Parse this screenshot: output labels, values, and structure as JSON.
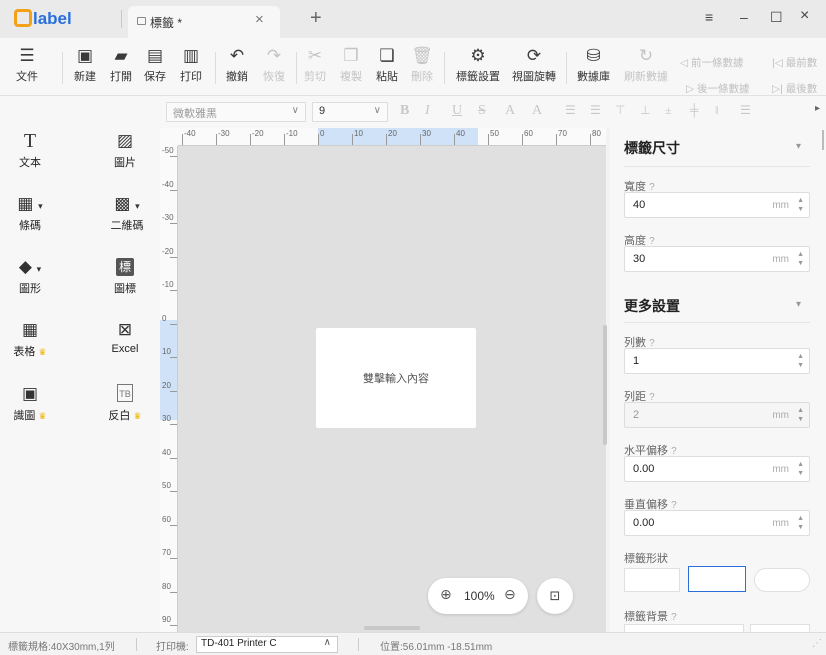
{
  "app": {
    "logo": "label",
    "tab_title": "標籤 *"
  },
  "window": {
    "menu_icon": "≡",
    "minimize": "–",
    "maximize": "☐",
    "close": "×",
    "new_tab": "+",
    "tab_close": "×"
  },
  "toolbar": {
    "file": "文件",
    "new": "新建",
    "open": "打開",
    "save": "保存",
    "print": "打印",
    "undo": "撤銷",
    "redo": "恢復",
    "cut": "剪切",
    "copy": "複製",
    "paste": "粘貼",
    "delete": "刪除",
    "label_settings": "標籤設置",
    "view_rotate": "視圖旋轉",
    "database": "數據庫",
    "refresh_data": "刷新數據",
    "prev_data": "前一條數據",
    "first_data": "最前數",
    "next_data": "後一條數據",
    "last_data": "最後數"
  },
  "left_tools": {
    "text": "文本",
    "image": "圖片",
    "barcode": "條碼",
    "qrcode": "二維碼",
    "shape": "圖形",
    "icon": "圖標",
    "icon_glyph": "標",
    "table": "表格",
    "excel": "Excel",
    "smart_image": "識圖",
    "invert": "反白",
    "invert_glyph": "TB"
  },
  "fontbar": {
    "font_family": "微軟雅黑",
    "font_size": "9"
  },
  "ruler": {
    "h_ticks": [
      "-40",
      "-30",
      "-20",
      "-10",
      "0",
      "10",
      "20",
      "30",
      "40",
      "50",
      "60",
      "70",
      "80"
    ],
    "v_ticks": [
      "-50",
      "-40",
      "-30",
      "-20",
      "-10",
      "0",
      "10",
      "20",
      "30",
      "40",
      "50",
      "60",
      "70",
      "80",
      "90"
    ]
  },
  "canvas": {
    "placeholder": "雙擊輸入內容",
    "zoom": "100%"
  },
  "properties": {
    "label_size_title": "標籤尺寸",
    "width_label": "寬度",
    "width_value": "40",
    "width_unit": "mm",
    "height_label": "高度",
    "height_value": "30",
    "height_unit": "mm",
    "more_title": "更多設置",
    "columns_label": "列數",
    "columns_value": "1",
    "col_gap_label": "列距",
    "col_gap_value": "2",
    "col_gap_unit": "mm",
    "h_offset_label": "水平偏移",
    "h_offset_value": "0.00",
    "h_offset_unit": "mm",
    "v_offset_label": "垂直偏移",
    "v_offset_value": "0.00",
    "v_offset_unit": "mm",
    "shape_label": "標籤形狀",
    "bg_label": "標籤背景"
  },
  "status": {
    "spec": "標籤規格:40X30mm,1列",
    "printer_label": "打印機:",
    "printer_value": "TD-401 Printer C",
    "position": "位置:56.01mm -18.51mm"
  },
  "colors": {
    "accent": "#2a6fdb",
    "crown": "#f0b400",
    "ruler_highlight": "#cfe2f7"
  }
}
